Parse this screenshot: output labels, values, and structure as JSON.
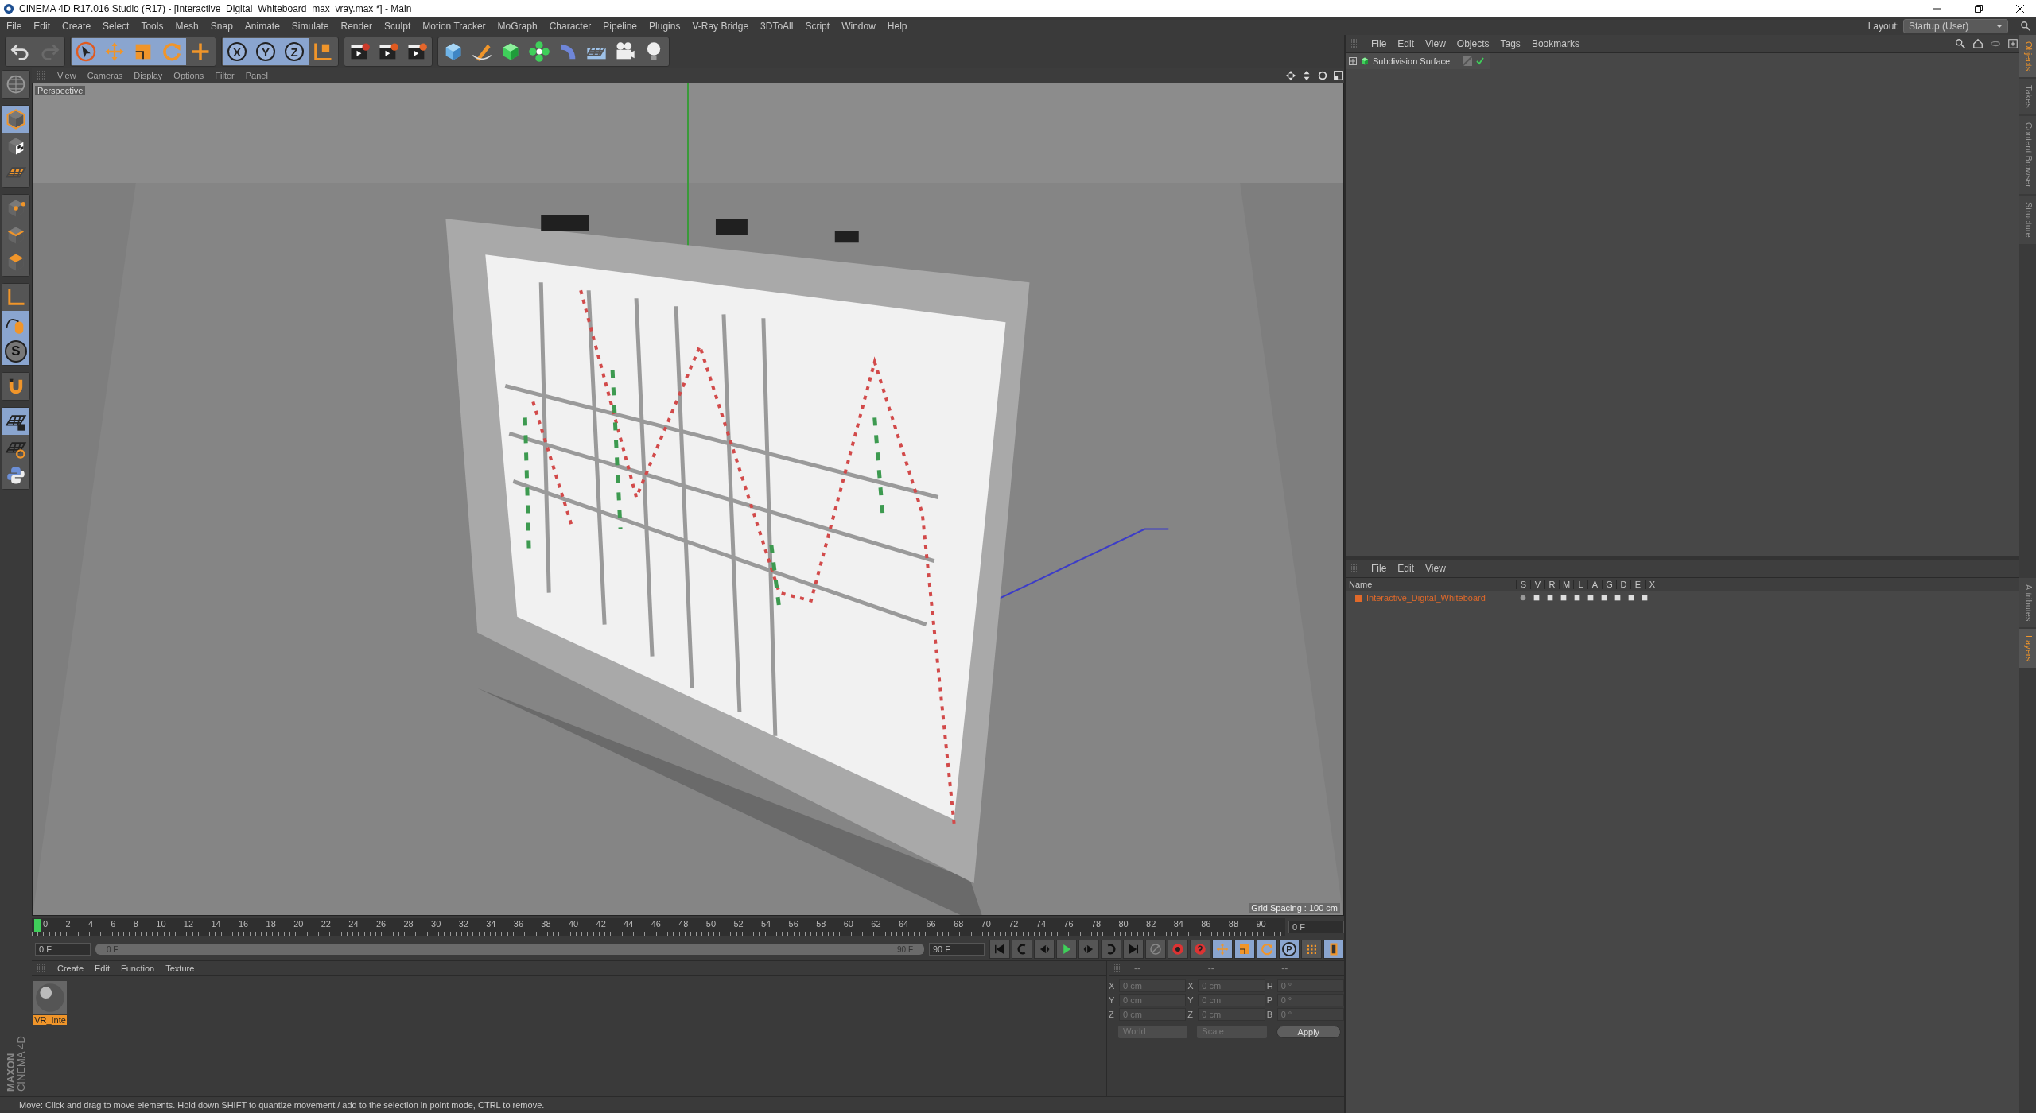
{
  "window": {
    "title": "CINEMA 4D R17.016 Studio (R17) - [Interactive_Digital_Whiteboard_max_vray.max *] - Main"
  },
  "menu": [
    "File",
    "Edit",
    "Create",
    "Select",
    "Tools",
    "Mesh",
    "Snap",
    "Animate",
    "Simulate",
    "Render",
    "Sculpt",
    "Motion Tracker",
    "MoGraph",
    "Character",
    "Pipeline",
    "Plugins",
    "V-Ray Bridge",
    "3DToAll",
    "Script",
    "Window",
    "Help"
  ],
  "layout": {
    "label": "Layout:",
    "value": "Startup (User)"
  },
  "toolbar": [
    [
      {
        "kind": "undo",
        "selected": false
      },
      {
        "kind": "redo",
        "selected": false
      }
    ],
    [
      {
        "kind": "select",
        "selected": true
      },
      {
        "kind": "move",
        "selected": true
      },
      {
        "kind": "scale",
        "selected": true
      },
      {
        "kind": "rotate",
        "selected": true
      },
      {
        "kind": "transform",
        "selected": false
      }
    ],
    [
      {
        "kind": "axis-lock",
        "label": "X",
        "selected": true
      },
      {
        "kind": "axis-lock",
        "label": "Y",
        "selected": true
      },
      {
        "kind": "axis-lock",
        "label": "Z",
        "selected": true
      },
      {
        "kind": "coord",
        "selected": false
      }
    ],
    [
      {
        "kind": "render-view",
        "selected": false
      },
      {
        "kind": "render",
        "selected": false
      },
      {
        "kind": "render-settings",
        "selected": false
      }
    ],
    [
      {
        "kind": "cube",
        "selected": false
      },
      {
        "kind": "pen",
        "selected": false
      },
      {
        "kind": "subdivision",
        "selected": false
      },
      {
        "kind": "cloner",
        "selected": false
      },
      {
        "kind": "deformer",
        "selected": false
      },
      {
        "kind": "floor",
        "selected": false
      },
      {
        "kind": "camera",
        "selected": false
      },
      {
        "kind": "light",
        "selected": false
      }
    ]
  ],
  "left_tools": [
    [
      {
        "kind": "globe",
        "selected": false
      }
    ],
    [
      {
        "kind": "model",
        "selected": true
      },
      {
        "kind": "texture",
        "selected": false
      },
      {
        "kind": "workplane",
        "selected": false
      }
    ],
    [
      {
        "kind": "points",
        "selected": false
      },
      {
        "kind": "edges",
        "selected": false
      },
      {
        "kind": "polygons",
        "selected": false
      }
    ],
    [
      {
        "kind": "axis",
        "selected": false
      },
      {
        "kind": "tweak",
        "selected": true
      },
      {
        "kind": "axis-lock",
        "label": "S",
        "selected": true
      }
    ],
    [
      {
        "kind": "magnet",
        "selected": false
      }
    ],
    [
      {
        "kind": "workplane-lock",
        "selected": true
      },
      {
        "kind": "workplane-align",
        "selected": false
      },
      {
        "kind": "python",
        "selected": false
      }
    ]
  ],
  "viewport": {
    "menu": [
      "View",
      "Cameras",
      "Display",
      "Options",
      "Filter",
      "Panel"
    ],
    "camera": "Perspective",
    "grid_spacing": "Grid Spacing : 100 cm"
  },
  "timeline": {
    "ticks": [
      "0",
      "2",
      "4",
      "6",
      "8",
      "10",
      "12",
      "14",
      "16",
      "18",
      "20",
      "22",
      "24",
      "26",
      "28",
      "30",
      "32",
      "34",
      "36",
      "38",
      "40",
      "42",
      "44",
      "46",
      "48",
      "50",
      "52",
      "54",
      "56",
      "58",
      "60",
      "62",
      "64",
      "66",
      "68",
      "70",
      "72",
      "74",
      "76",
      "78",
      "80",
      "82",
      "84",
      "86",
      "88",
      "90"
    ],
    "current_frame": "0 F",
    "start": "0 F",
    "range_start": "0 F",
    "range_end": "90 F",
    "end": "90 F"
  },
  "transport": [
    {
      "kind": "to-start",
      "selected": false
    },
    {
      "kind": "prev-key",
      "selected": false
    },
    {
      "kind": "prev-frame",
      "selected": false
    },
    {
      "kind": "play",
      "selected": false
    },
    {
      "kind": "next-frame",
      "selected": false
    },
    {
      "kind": "next-key",
      "selected": false
    },
    {
      "kind": "to-end",
      "selected": false
    },
    {
      "kind": "record-off",
      "selected": false
    },
    {
      "kind": "record",
      "selected": false
    },
    {
      "kind": "autokey",
      "selected": false
    },
    {
      "kind": "move",
      "selected": true
    },
    {
      "kind": "scale",
      "selected": true
    },
    {
      "kind": "rotate",
      "selected": true
    },
    {
      "kind": "axis-lock",
      "label": "P",
      "selected": true
    },
    {
      "kind": "dots",
      "selected": false
    },
    {
      "kind": "film",
      "selected": true
    }
  ],
  "materials": {
    "menu": [
      "Create",
      "Edit",
      "Function",
      "Texture"
    ],
    "items": [
      {
        "name": "VR_Inte",
        "selected": true
      }
    ]
  },
  "coordinates": {
    "headers": [
      "--",
      "--",
      "--"
    ],
    "columns": [
      [
        {
          "axis": "X",
          "value": "0 cm"
        },
        {
          "axis": "Y",
          "value": "0 cm"
        },
        {
          "axis": "Z",
          "value": "0 cm"
        }
      ],
      [
        {
          "axis": "X",
          "value": "0 cm"
        },
        {
          "axis": "Y",
          "value": "0 cm"
        },
        {
          "axis": "Z",
          "value": "0 cm"
        }
      ],
      [
        {
          "axis": "H",
          "value": "0 °"
        },
        {
          "axis": "P",
          "value": "0 °"
        },
        {
          "axis": "B",
          "value": "0 °"
        }
      ]
    ],
    "mode": "World",
    "size_mode": "Scale",
    "apply": "Apply"
  },
  "logo": {
    "brand": "MAXON",
    "product": "CINEMA 4D"
  },
  "status": "Move: Click and drag to move elements. Hold down SHIFT to quantize movement / add to the selection in point mode, CTRL to remove.",
  "objects": {
    "menu": [
      "File",
      "Edit",
      "View",
      "Objects",
      "Tags",
      "Bookmarks"
    ],
    "items": [
      {
        "name": "Subdivision Surface",
        "enabled": true
      }
    ]
  },
  "layers": {
    "menu": [
      "File",
      "Edit",
      "View"
    ],
    "columns": [
      "Name",
      "S",
      "V",
      "R",
      "M",
      "L",
      "A",
      "G",
      "D",
      "E",
      "X"
    ],
    "items": [
      {
        "name": "Interactive_Digital_Whiteboard",
        "color": "#e0692a"
      }
    ]
  },
  "side_tabs": [
    {
      "label": "Objects",
      "selected": true
    },
    {
      "label": "Takes",
      "selected": false
    },
    {
      "label": "Content Browser",
      "selected": false
    },
    {
      "label": "Structure",
      "selected": false
    }
  ],
  "side_tabs_lower": [
    {
      "label": "Attributes",
      "selected": false
    },
    {
      "label": "Layers",
      "selected": true
    }
  ]
}
